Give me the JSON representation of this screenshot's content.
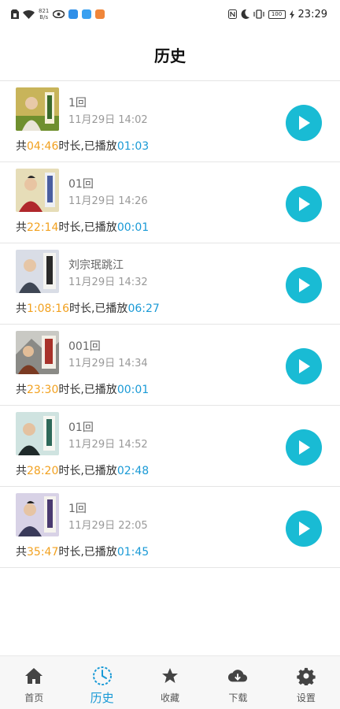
{
  "status_bar": {
    "speed_value": "821",
    "speed_unit": "B/s",
    "battery": "100",
    "time": "23:29"
  },
  "header": {
    "title": "历史"
  },
  "history": [
    {
      "title": "1回",
      "date": "11月29日 14:02",
      "prefix": "共",
      "duration": "04:46",
      "middle": "时长,已播放",
      "played": "01:03"
    },
    {
      "title": "01回",
      "date": "11月29日 14:26",
      "prefix": "共",
      "duration": "22:14",
      "middle": "时长,已播放",
      "played": "00:01"
    },
    {
      "title": "刘宗珉跳江",
      "date": "11月29日 14:32",
      "prefix": "共",
      "duration": "1:08:16",
      "middle": "时长,已播放",
      "played": "06:27"
    },
    {
      "title": "001回",
      "date": "11月29日 14:34",
      "prefix": "共",
      "duration": "23:30",
      "middle": "时长,已播放",
      "played": "00:01"
    },
    {
      "title": "01回",
      "date": "11月29日 14:52",
      "prefix": "共",
      "duration": "28:20",
      "middle": "时长,已播放",
      "played": "02:48"
    },
    {
      "title": "1回",
      "date": "11月29日 22:05",
      "prefix": "共",
      "duration": "35:47",
      "middle": "时长,已播放",
      "played": "01:45"
    }
  ],
  "tabs": [
    {
      "label": "首页",
      "icon": "home-icon"
    },
    {
      "label": "历史",
      "icon": "clock-icon",
      "active": true
    },
    {
      "label": "收藏",
      "icon": "star-icon"
    },
    {
      "label": "下载",
      "icon": "cloud-download-icon"
    },
    {
      "label": "设置",
      "icon": "gear-icon"
    }
  ],
  "colors": {
    "accent": "#1a9ad6",
    "play_button": "#19bbd4",
    "duration": "#f2a11f"
  }
}
